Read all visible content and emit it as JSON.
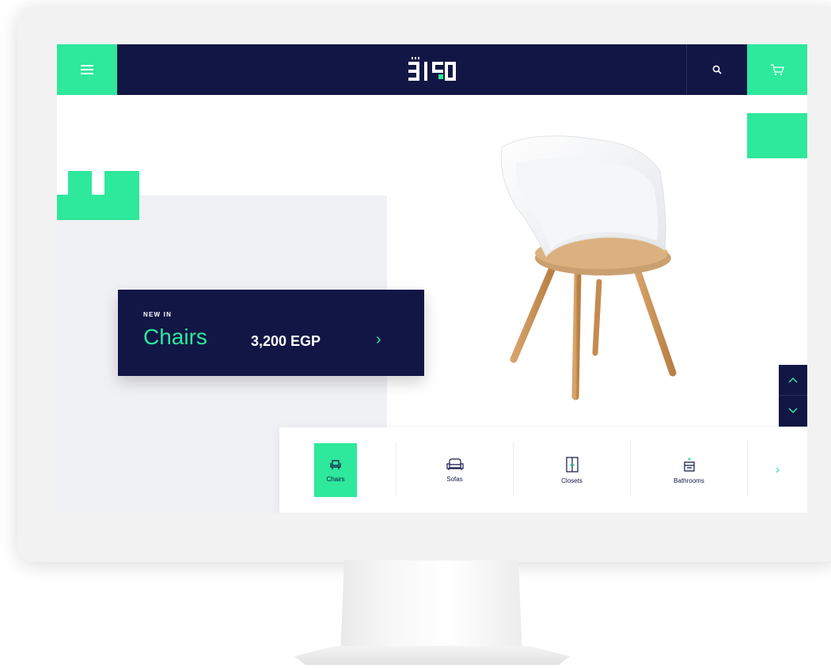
{
  "colors": {
    "accent": "#2ee89b",
    "navy": "#121645",
    "panel_gray": "#f0f1f5"
  },
  "header": {
    "menu_icon": "hamburger-icon",
    "logo_alt": "brand-logo",
    "search_icon": "search-icon",
    "cart_icon": "cart-icon"
  },
  "promo": {
    "tag": "NEW IN",
    "category": "Chairs",
    "price": "3,200 EGP",
    "arrow": "›"
  },
  "scroll": {
    "up_icon": "chevron-up-icon",
    "down_icon": "chevron-down-icon"
  },
  "categories": {
    "active_index": 0,
    "items": [
      {
        "label": "Chairs",
        "icon": "chair-icon"
      },
      {
        "label": "Sofas",
        "icon": "sofa-icon"
      },
      {
        "label": "Closets",
        "icon": "closet-icon"
      },
      {
        "label": "Bathrooms",
        "icon": "bathroom-icon"
      }
    ],
    "next_arrow": "›"
  }
}
